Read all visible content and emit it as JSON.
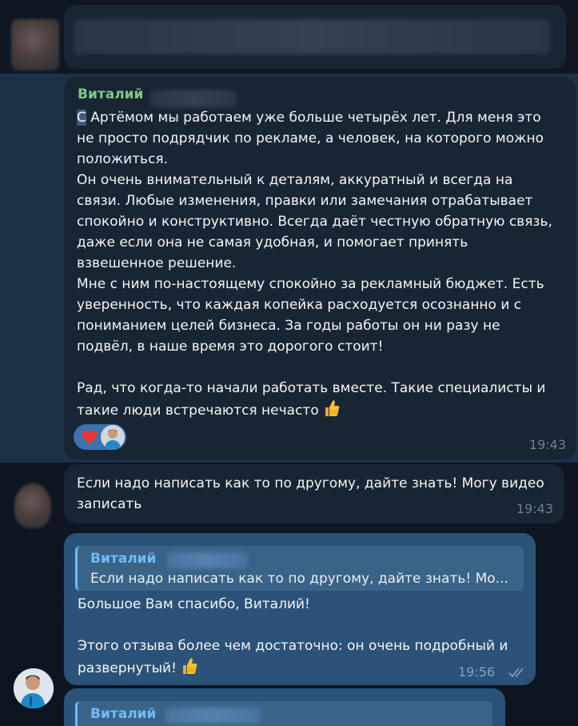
{
  "messages": [
    {
      "sender": "Виталий",
      "cursor_char": "С",
      "text": " Артёмом мы работаем уже больше четырёх лет. Для меня это\nне просто подрядчик по рекламе, а человек, на которого можно\nположиться.\nОн очень внимательный к деталям, аккуратный и всегда на\nсвязи. Любые изменения, правки или замечания отрабатывает\nспокойно и конструктивно. Всегда даёт честную обратную связь,\nдаже если она не самая удобная, и помогает принять\nвзвешенное решение.\nМне с ним по-настоящему спокойно за рекламный бюджет. Есть\nуверенность, что каждая копейка расходуется осознанно и с\nпониманием целей бизнеса. За годы работы он ни разу не\nподвёл, в наше время это дорогого стоит!\n\nРад, что когда-то начали работать вместе. Такие специалисты и\nтакие люди встречаются нечасто ",
      "emoji": "thumbs-up",
      "reaction": "heart",
      "time": "19:43"
    },
    {
      "text": "Если надо написать как то по другому, дайте знать! Могу видео\nзаписать",
      "time": "19:43"
    },
    {
      "reply_sender": "Виталий",
      "reply_text": "Если надо написать как то по другому, дайте знать! Мо...",
      "text": "Большое Вам спасибо, Виталий!\n\nЭтого отзыва более чем достаточно: он очень подробный и\nразвернутый! ",
      "emoji": "thumbs-up",
      "time": "19:56",
      "status": "read"
    },
    {
      "reply_sender": "Виталий"
    }
  ],
  "colors": {
    "background": "#0e1621",
    "incoming_bubble": "#182533",
    "outgoing_bubble": "#2b5278",
    "sender_green": "#7ec785",
    "sender_blue": "#71baf5",
    "reaction": "#3a73b0"
  }
}
